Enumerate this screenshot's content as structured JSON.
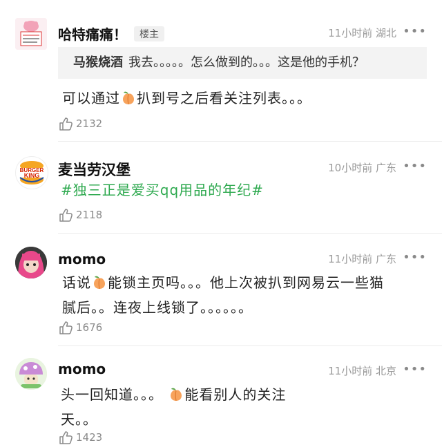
{
  "comments": [
    {
      "name": "哈特痛痛！",
      "badge": "楼主",
      "time": "11小时前",
      "location": "湖北",
      "more": "•••",
      "quote": {
        "author": "马猴烧酒",
        "text": "我去。。。。。怎么做到的。。。这是他的手机？"
      },
      "text_before": "可以通过",
      "text_after": "扒到号之后看关注列表。。。",
      "likes": "2132"
    },
    {
      "name": "麦当劳汉堡",
      "time": "10小时前",
      "location": "广东",
      "more": "•••",
      "avatar_text_1": "BURGER",
      "avatar_text_2": "KING",
      "text": "#独三正是爱买qq用品的年纪#",
      "likes": "2118"
    },
    {
      "name": "momo",
      "time": "11小时前",
      "location": "广东",
      "more": "•••",
      "text_before": "话说",
      "text_after": "能锁主页吗。。。他上次被扒到网易云一些猫",
      "text_line2": "腻后。。连夜上线锁了。。。。。。",
      "likes": "1676"
    },
    {
      "name": "momo",
      "time": "11小时前",
      "location": "北京",
      "more": "•••",
      "text_before": "头一回知道。。。",
      "text_after": "能看别人的关注",
      "text_line2": "天。。",
      "likes": "1423"
    }
  ],
  "colors": {
    "hashtag": "#2ea94f",
    "meta": "#9a9a9a",
    "quote_bg": "#f3f3f3"
  }
}
